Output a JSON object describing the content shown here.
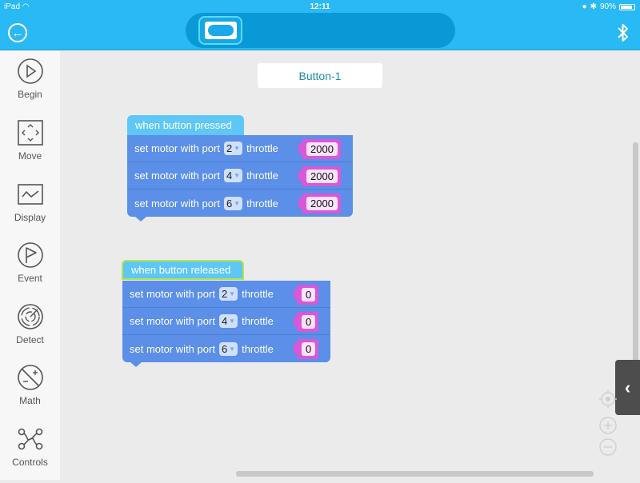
{
  "status_bar": {
    "device": "iPad",
    "time": "12:11",
    "battery": "90%",
    "battery_level": 0.9
  },
  "header": {
    "back_icon": "back-arrow-icon",
    "device_icon": "button-device-icon",
    "bluetooth_icon": "bluetooth-icon"
  },
  "sidebar": {
    "items": [
      {
        "label": "Begin",
        "icon": "play-icon"
      },
      {
        "label": "Move",
        "icon": "move-icon"
      },
      {
        "label": "Display",
        "icon": "display-icon"
      },
      {
        "label": "Event",
        "icon": "flag-icon"
      },
      {
        "label": "Detect",
        "icon": "radar-icon"
      },
      {
        "label": "Math",
        "icon": "math-icon"
      },
      {
        "label": "Controls",
        "icon": "controls-icon"
      }
    ]
  },
  "canvas": {
    "component_name": "Button-1",
    "stacks": [
      {
        "hat": "when button pressed",
        "selected": false,
        "blocks": [
          {
            "prefix": "set motor with port",
            "port": "2",
            "mid": "throttle",
            "value": "2000"
          },
          {
            "prefix": "set motor with port",
            "port": "4",
            "mid": "throttle",
            "value": "2000"
          },
          {
            "prefix": "set motor with port",
            "port": "6",
            "mid": "throttle",
            "value": "2000"
          }
        ]
      },
      {
        "hat": "when button released",
        "selected": true,
        "blocks": [
          {
            "prefix": "set motor with port",
            "port": "2",
            "mid": "throttle",
            "value": "0"
          },
          {
            "prefix": "set motor with port",
            "port": "4",
            "mid": "throttle",
            "value": "0"
          },
          {
            "prefix": "set motor with port",
            "port": "6",
            "mid": "throttle",
            "value": "0"
          }
        ]
      }
    ],
    "controls": {
      "recenter": "recenter-icon",
      "zoom_in": "zoom-in-icon",
      "zoom_out": "zoom-out-icon",
      "drawer": "chevron-left-icon"
    }
  },
  "colors": {
    "header": "#29b9f5",
    "hat": "#5ec7f5",
    "block": "#5b8fe8",
    "number_input": "#d957d9",
    "selected_outline": "#b5e24a"
  }
}
